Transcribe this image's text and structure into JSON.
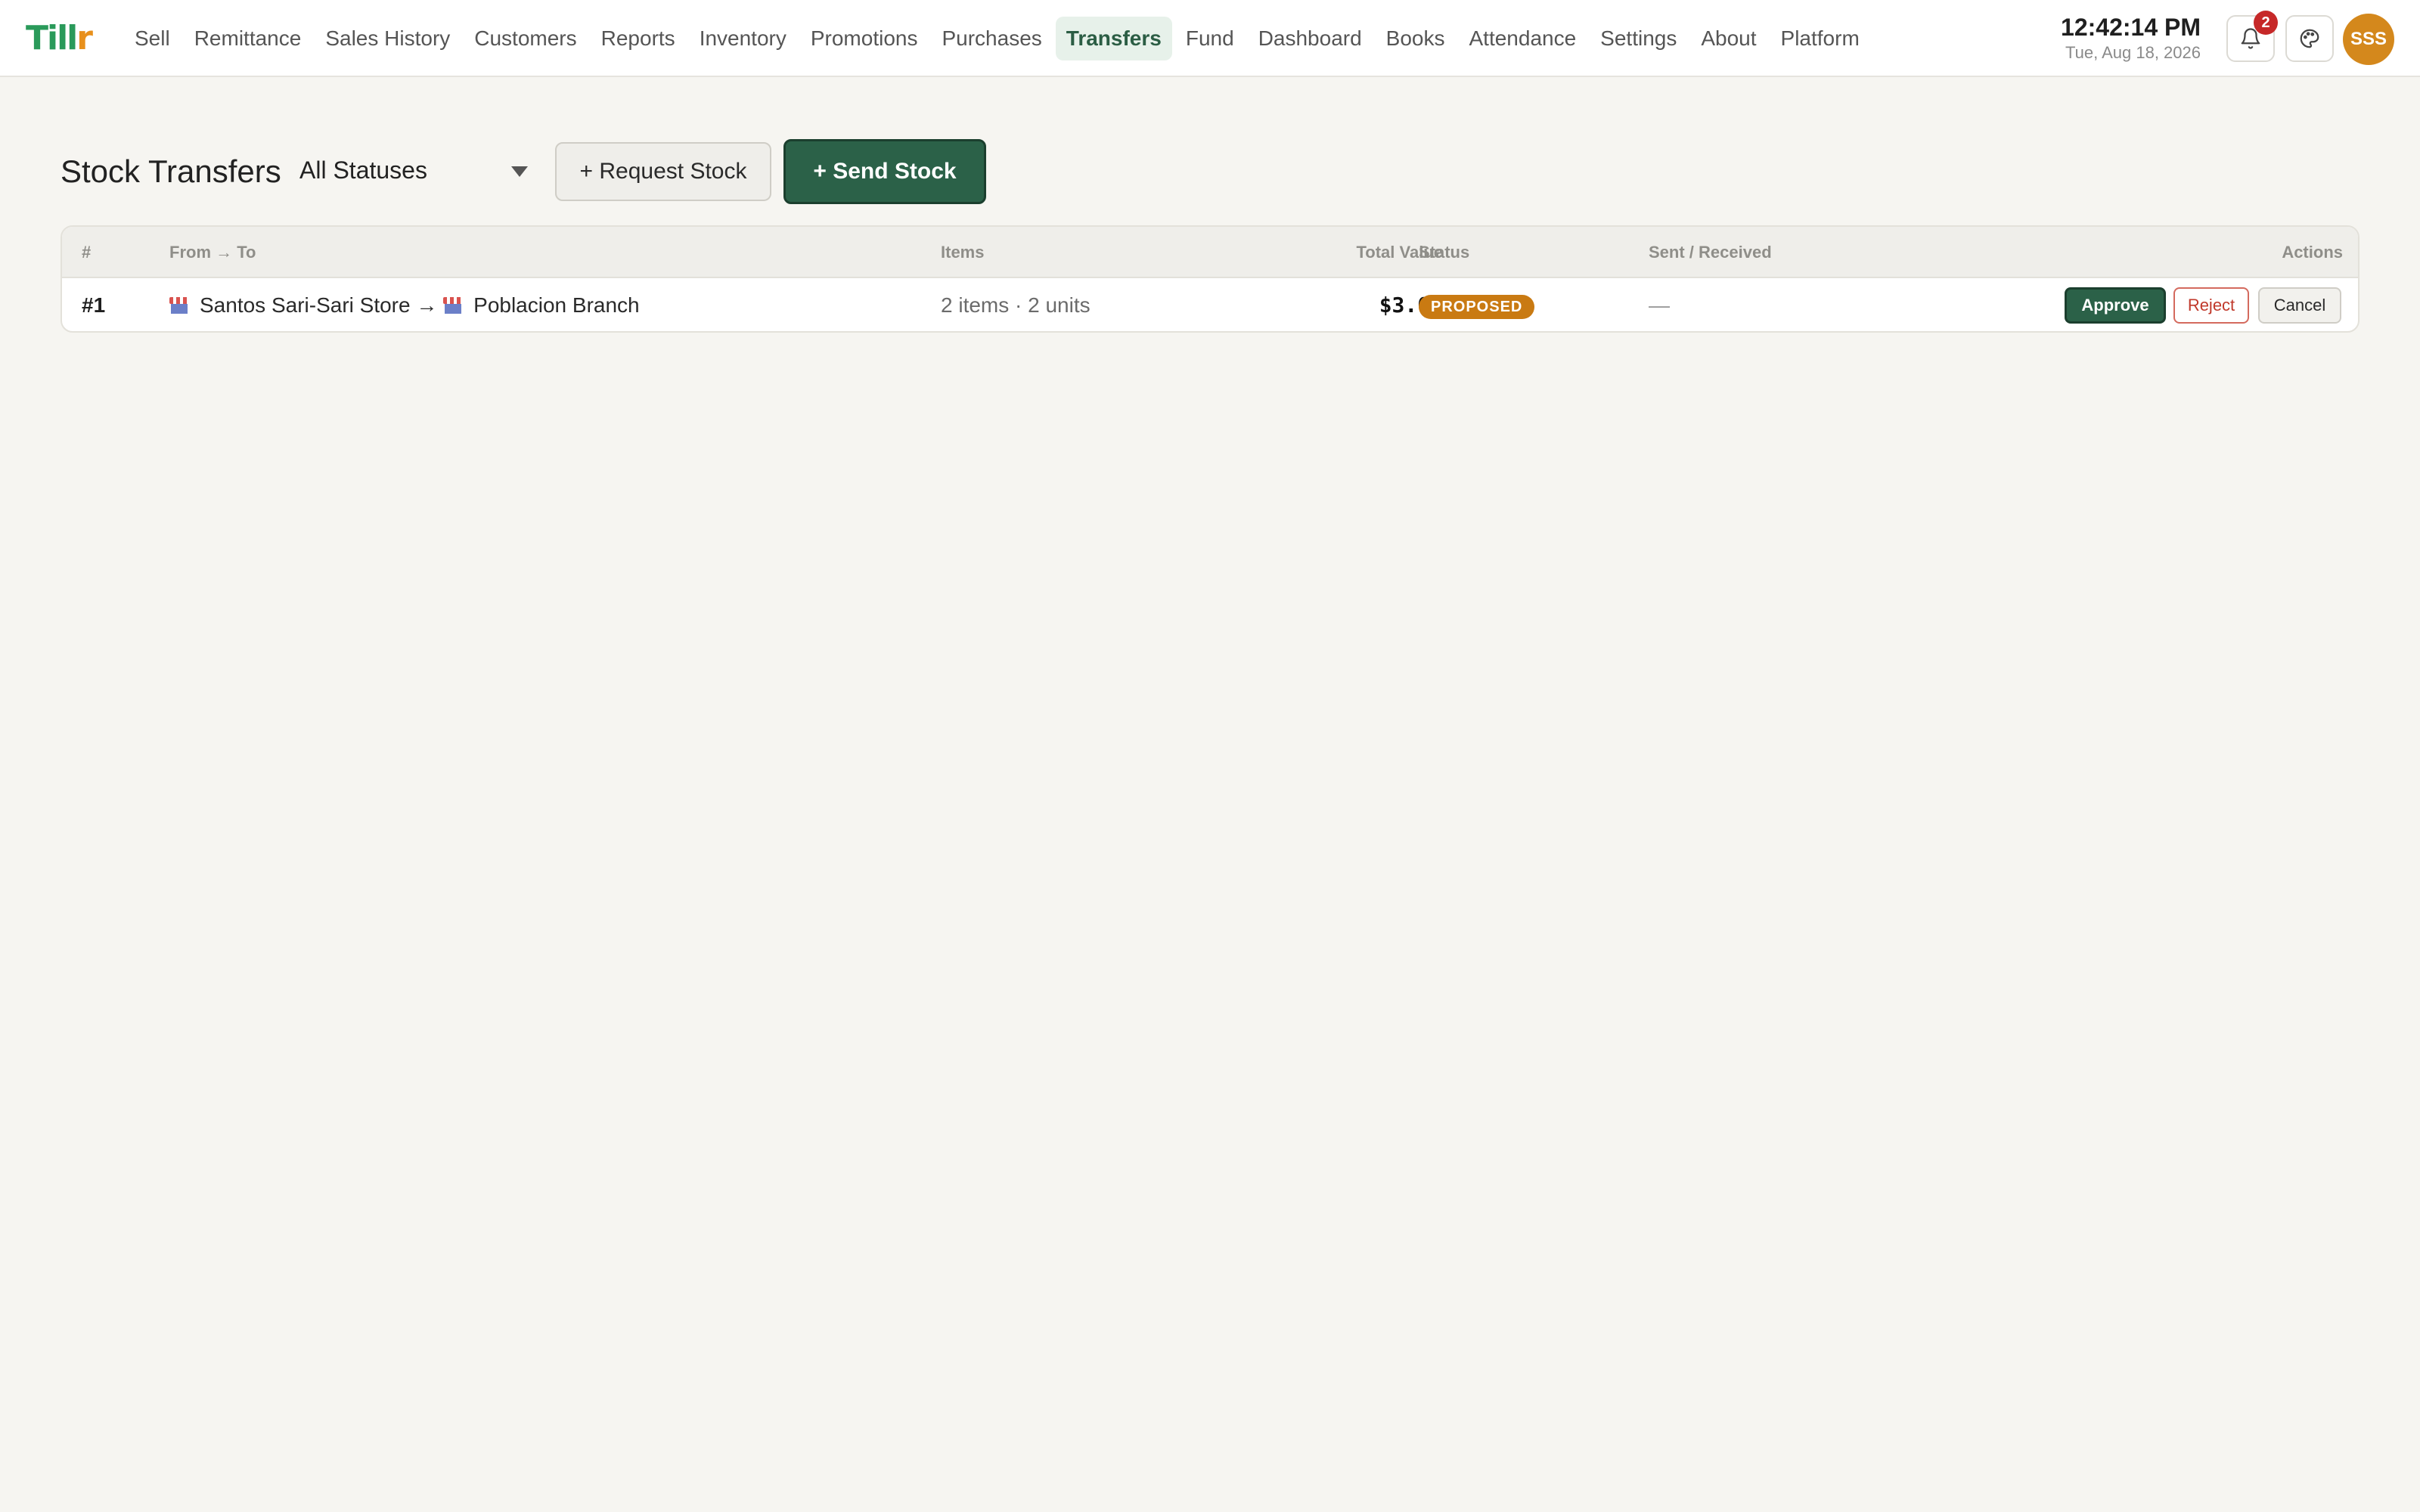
{
  "brand": {
    "logo_main": "Till",
    "logo_accent": "r"
  },
  "nav": {
    "items": [
      {
        "label": "Sell"
      },
      {
        "label": "Remittance"
      },
      {
        "label": "Sales History"
      },
      {
        "label": "Customers"
      },
      {
        "label": "Reports"
      },
      {
        "label": "Inventory"
      },
      {
        "label": "Promotions"
      },
      {
        "label": "Purchases"
      },
      {
        "label": "Transfers",
        "active": true
      },
      {
        "label": "Fund"
      },
      {
        "label": "Dashboard"
      },
      {
        "label": "Books"
      },
      {
        "label": "Attendance"
      },
      {
        "label": "Settings"
      },
      {
        "label": "About"
      },
      {
        "label": "Platform"
      }
    ]
  },
  "header": {
    "time": "12:42:14 PM",
    "date": "Tue, Aug 18, 2026",
    "notification_count": "2",
    "avatar_initials": "SSS"
  },
  "page": {
    "title": "Stock Transfers",
    "status_filter": "All Statuses",
    "request_button": "+ Request Stock",
    "send_button": "+ Send Stock"
  },
  "table": {
    "columns": {
      "num": "#",
      "route": "From → To",
      "items": "Items",
      "total": "Total Value",
      "status": "Status",
      "sent": "Sent / Received",
      "actions": "Actions"
    },
    "rows": [
      {
        "num": "#1",
        "from": "Santos Sari-Sari Store",
        "arrow": "→",
        "to": "Poblacion Branch",
        "items": "2 items · 2 units",
        "total": "$3.00",
        "status": "PROPOSED",
        "sent": "—",
        "approve": "Approve",
        "reject": "Reject",
        "cancel": "Cancel"
      }
    ]
  },
  "colors": {
    "accent": "#2b6148",
    "status_proposed": "#c97a12",
    "badge": "#c62828",
    "avatar": "#d4881c"
  }
}
